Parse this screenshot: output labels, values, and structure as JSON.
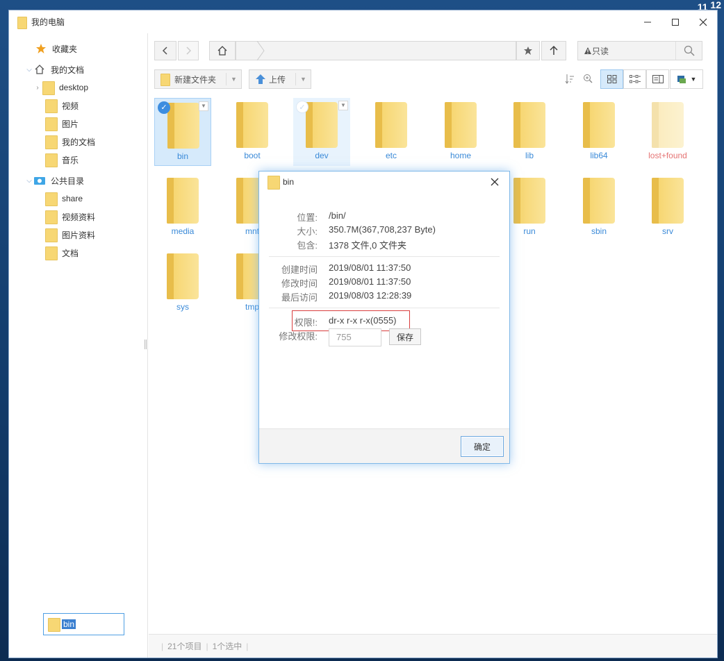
{
  "clock": {
    "line1": "11",
    "line2": "12"
  },
  "window": {
    "title": "我的电脑"
  },
  "sidebar": {
    "favorites": "收藏夹",
    "my_docs": "我的文档",
    "my_docs_children": [
      "desktop",
      "视频",
      "图片",
      "我的文档",
      "音乐"
    ],
    "public": "公共目录",
    "public_children": [
      "share",
      "视频资料",
      "图片资料",
      "文档"
    ],
    "selected_item": "bin"
  },
  "toolbar": {
    "readonly": "只读",
    "new_folder": "新建文件夹",
    "upload": "上传"
  },
  "files": [
    {
      "name": "bin",
      "state": "selected"
    },
    {
      "name": "boot",
      "state": "normal"
    },
    {
      "name": "dev",
      "state": "hover"
    },
    {
      "name": "etc",
      "state": "normal"
    },
    {
      "name": "home",
      "state": "normal"
    },
    {
      "name": "lib",
      "state": "normal"
    },
    {
      "name": "lib64",
      "state": "normal"
    },
    {
      "name": "lost+found",
      "state": "faded"
    },
    {
      "name": "media",
      "state": "normal"
    },
    {
      "name": "mnt",
      "state": "normal"
    },
    {
      "name": "run",
      "state": "normal"
    },
    {
      "name": "sbin",
      "state": "normal"
    },
    {
      "name": "srv",
      "state": "normal"
    },
    {
      "name": "sys",
      "state": "normal"
    },
    {
      "name": "tmp",
      "state": "normal"
    }
  ],
  "statusbar": {
    "count": "21个项目",
    "selected": "1个选中"
  },
  "dialog": {
    "title": "bin",
    "location_label": "位置:",
    "location": "/bin/",
    "size_label": "大小:",
    "size": "350.7M(367,708,237 Byte)",
    "contains_label": "包含:",
    "contains": "1378 文件,0 文件夹",
    "created_label": "创建时间",
    "created": "2019/08/01 11:37:50",
    "modified_label": "修改时间",
    "modified": "2019/08/01 11:37:50",
    "accessed_label": "最后访问",
    "accessed": "2019/08/03 12:28:39",
    "perm_label": "权限!:",
    "perm": "dr-x r-x r-x(0555)",
    "edit_perm_label": "修改权限:",
    "edit_perm_value": "755",
    "save": "保存",
    "ok": "确定"
  },
  "colors": {
    "accent": "#3c8de0",
    "folder": "#f7d774",
    "highlight": "#d83c3c"
  }
}
